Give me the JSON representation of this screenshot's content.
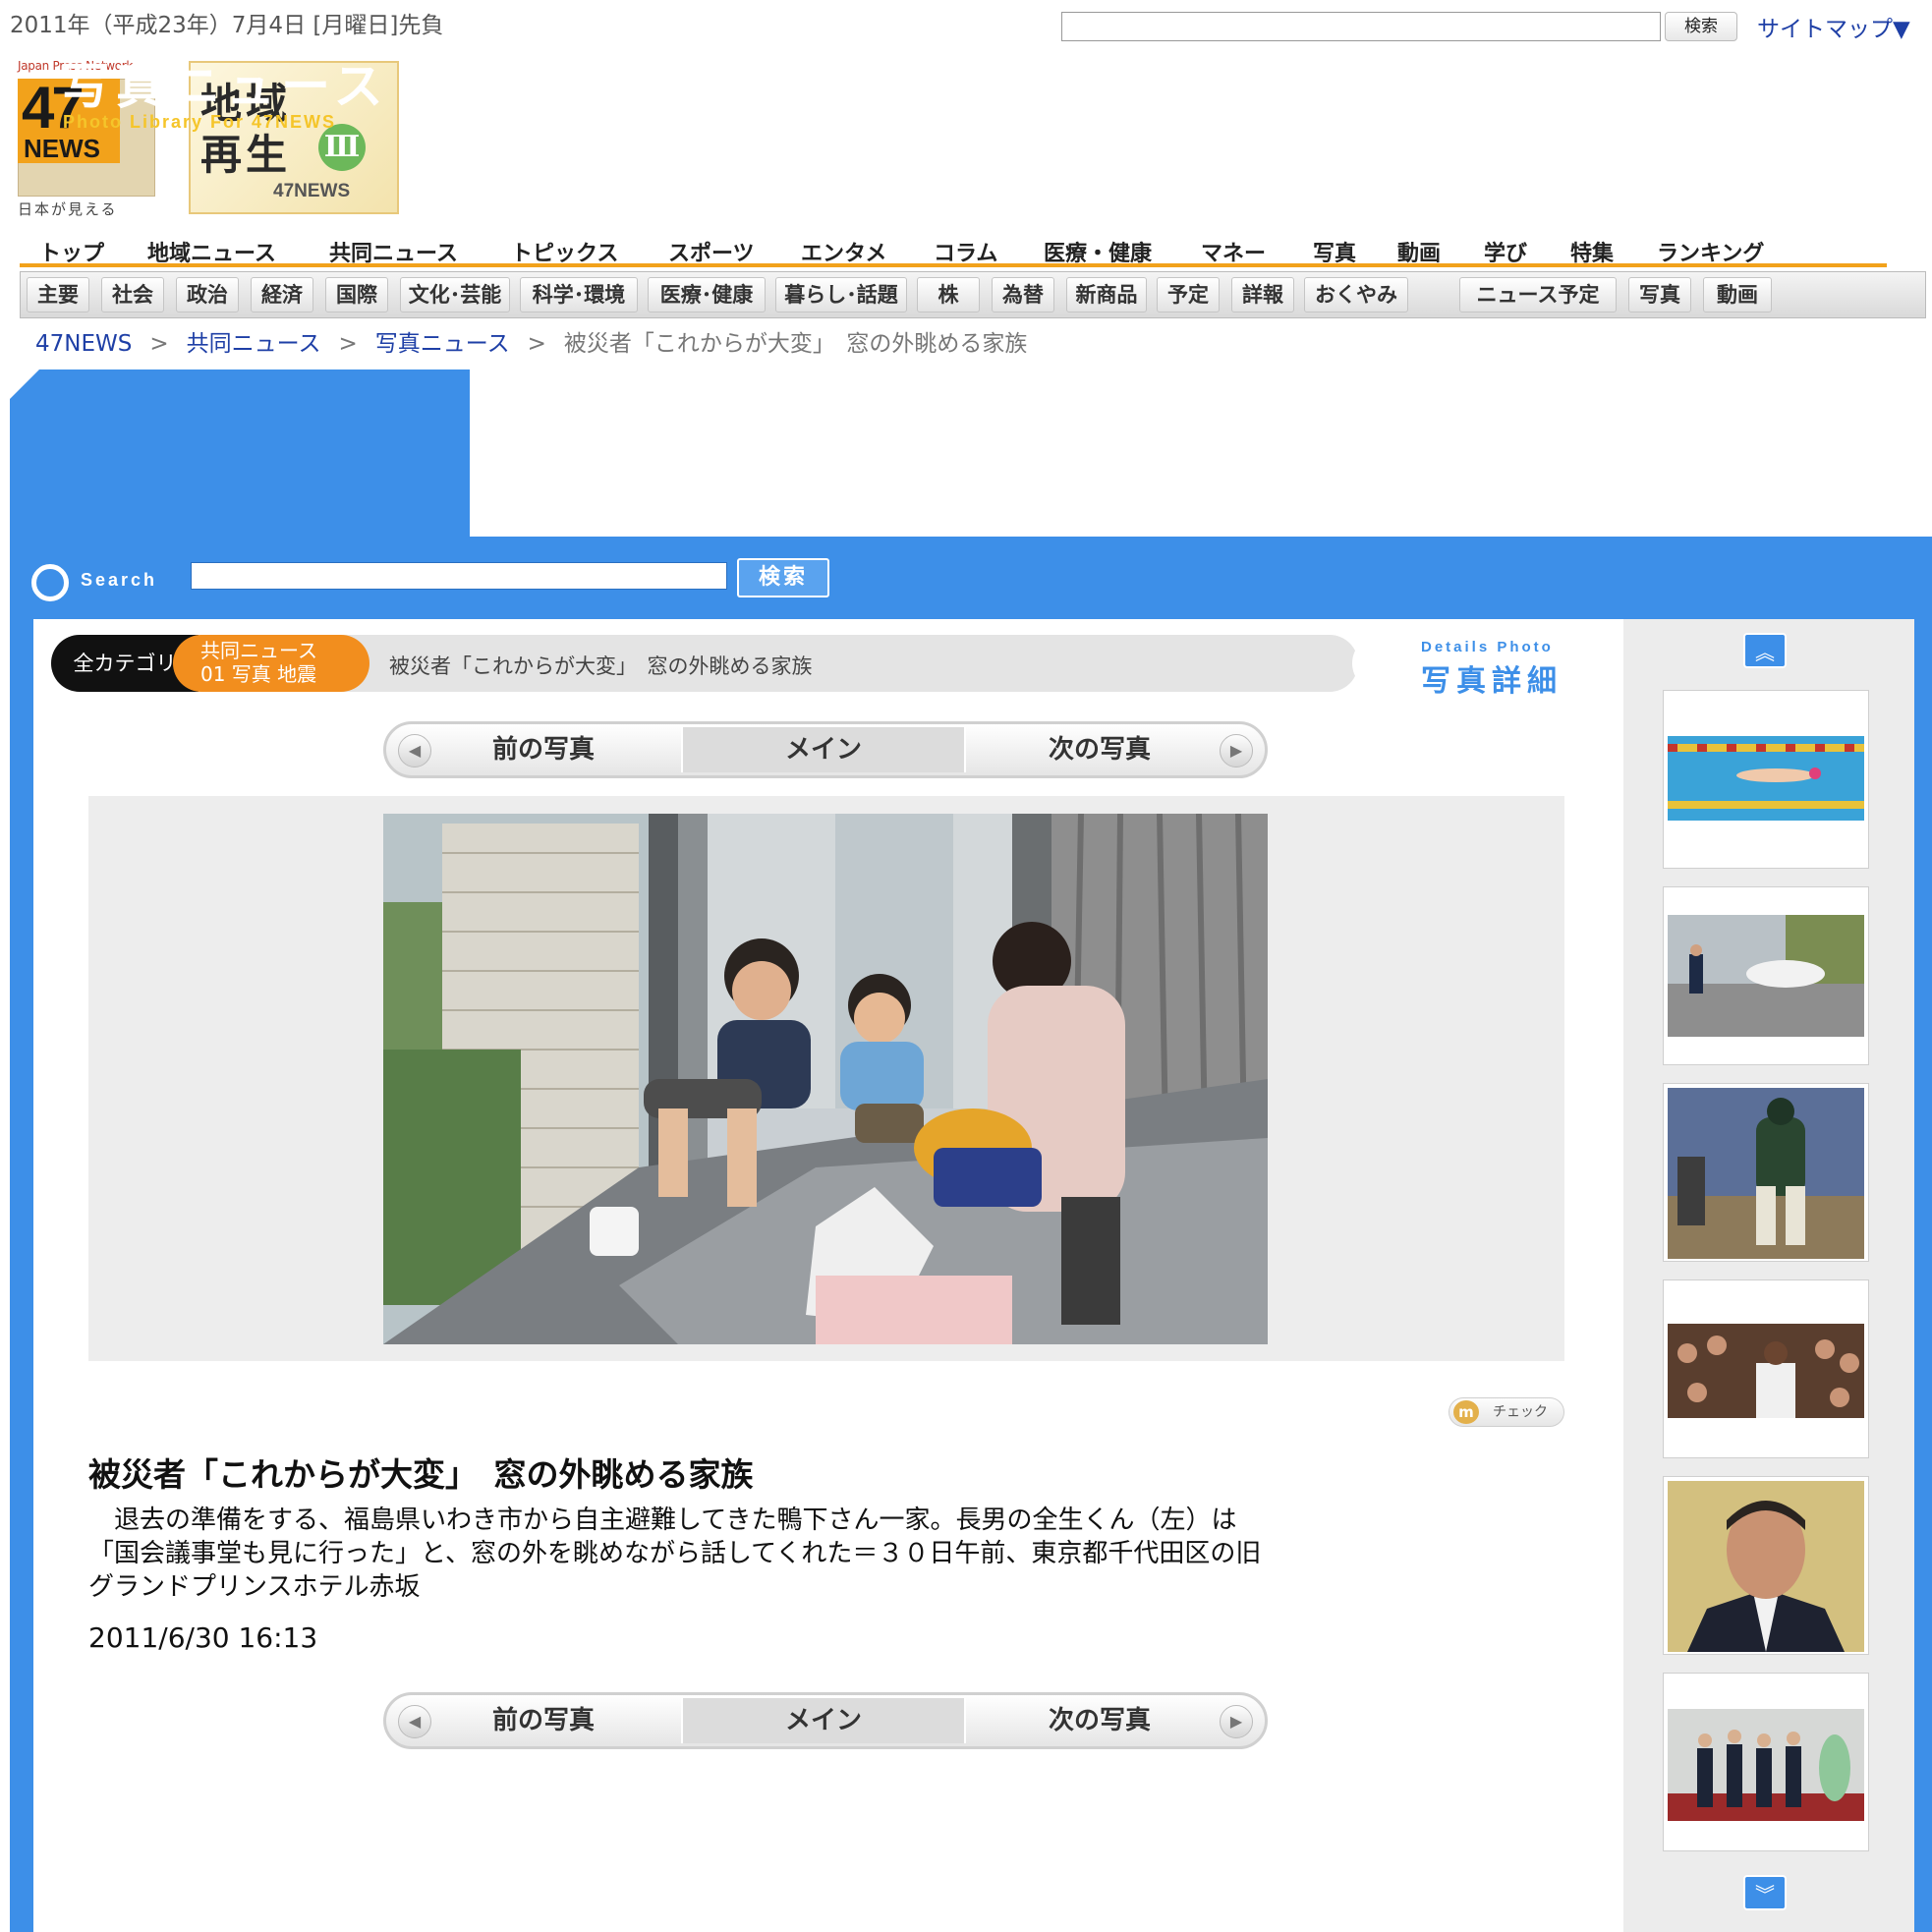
{
  "top": {
    "date": "2011年（平成23年）7月4日 [月曜日]先負",
    "search_button": "検索",
    "sitemap": "サイトマップ▼"
  },
  "logos": {
    "japan_press_network": "Japan Press Network",
    "news_number": "47",
    "news_word": "NEWS",
    "tagline": "日本が見える",
    "chiiki_line1": "地域",
    "chiiki_line2": "再生",
    "chiiki_roman": "Ⅲ",
    "chiiki_sub": "47NEWS"
  },
  "main_nav": [
    "トップ",
    "地域ニュース",
    "共同ニュース",
    "トピックス",
    "スポーツ",
    "エンタメ",
    "コラム",
    "医療・健康",
    "マネー",
    "写真",
    "動画",
    "学び",
    "特集",
    "ランキング"
  ],
  "sub_nav": [
    "主要",
    "社会",
    "政治",
    "経済",
    "国際",
    "文化･芸能",
    "科学･環境",
    "医療･健康",
    "暮らし･話題",
    "株",
    "為替",
    "新商品",
    "予定",
    "詳報",
    "おくやみ",
    "ニュース予定",
    "写真",
    "動画"
  ],
  "breadcrumb": {
    "items": [
      "47NEWS",
      "共同ニュース",
      "写真ニュース"
    ],
    "separator": ">",
    "current": "被災者「これからが大変」　窓の外眺める家族"
  },
  "photo_section": {
    "title": "写真ニュース",
    "subtitle": "Photo Library For 47NEWS",
    "search_label": "Search",
    "search_button": "検索"
  },
  "category": {
    "all": "全カテゴリ",
    "line1": "共同ニュース",
    "line2": "01 写真 地震",
    "title": "被災者「これからが大変」　窓の外眺める家族",
    "details_en": "Details Photo",
    "details_jp": "写真詳細"
  },
  "pager": {
    "prev": "前の写真",
    "main": "メイン",
    "next": "次の写真",
    "prev_arrow": "◀",
    "next_arrow": "▶"
  },
  "article": {
    "check_icon": "m",
    "check": "チェック",
    "headline": "被災者「これからが大変」　窓の外眺める家族",
    "caption_lines": [
      "　退去の準備をする、福島県いわき市から自主避難してきた鴨下さん一家。長男の全生くん（左）は",
      "「国会議事堂も見に行った」と、窓の外を眺めながら話してくれた＝３０日午前、東京都千代田区の旧",
      "グランドプリンスホテル赤坂"
    ],
    "timestamp": "2011/6/30 16:13"
  },
  "sidebar": {
    "up_arrow": "︽",
    "down_arrow": "︾",
    "thumbnails": [
      "swimming-photo",
      "helicopter-photo",
      "baseball-photo",
      "speech-photo",
      "portrait-photo",
      "ceremony-photo"
    ]
  },
  "colors": {
    "accent_blue": "#3d8fe8",
    "accent_orange": "#f28e1e",
    "link_blue": "#1e3fa6",
    "logo_yellow": "#f5c52a"
  }
}
